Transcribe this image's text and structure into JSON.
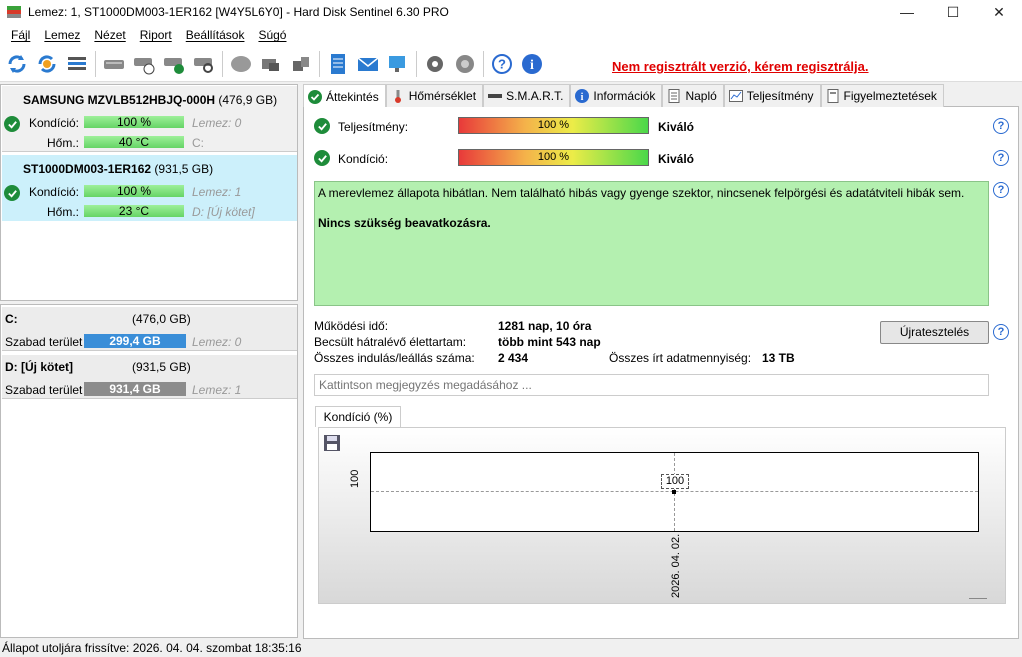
{
  "window": {
    "title": "Lemez: 1, ST1000DM003-1ER162 [W4Y5L6Y0]  -  Hard Disk Sentinel 6.30 PRO",
    "minimize": "—",
    "maximize": "☐",
    "close": "✕"
  },
  "menu": [
    "Fájl",
    "Lemez",
    "Nézet",
    "Riport",
    "Beállítások",
    "Súgó"
  ],
  "toolbar": {
    "registration_link": "Nem regisztrált verzió, kérem regisztrálja."
  },
  "disks": [
    {
      "name": "SAMSUNG MZVLB512HBJQ-000H",
      "size": "(476,9 GB)",
      "condition_label": "Kondíció:",
      "condition_value": "100 %",
      "temp_label": "Hőm.:",
      "temp_value": "40 °C",
      "disk_ref": "Lemez: 0",
      "volume": "C:"
    },
    {
      "name": "ST1000DM003-1ER162",
      "size": "(931,5 GB)",
      "condition_label": "Kondíció:",
      "condition_value": "100 %",
      "temp_label": "Hőm.:",
      "temp_value": "23 °C",
      "disk_ref": "Lemez: 1",
      "volume": "D: [Új kötet]"
    }
  ],
  "volumes": [
    {
      "name": "C:",
      "size": "(476,0 GB)",
      "free_label": "Szabad terület",
      "free_value": "299,4 GB",
      "free_color": "#3a8ed8",
      "disk_ref": "Lemez: 0"
    },
    {
      "name": "D: [Új kötet]",
      "size": "(931,5 GB)",
      "free_label": "Szabad terület",
      "free_value": "931,4 GB",
      "free_color": "#8c8c8c",
      "disk_ref": "Lemez: 1"
    }
  ],
  "tabs": [
    "Áttekintés",
    "Hőmérséklet",
    "S.M.A.R.T.",
    "Információk",
    "Napló",
    "Teljesítmény",
    "Figyelmeztetések"
  ],
  "overview": {
    "performance_label": "Teljesítmény:",
    "performance_value": "100 %",
    "performance_rating": "Kiváló",
    "condition_label": "Kondíció:",
    "condition_value": "100 %",
    "condition_rating": "Kiváló",
    "status_text": "A merevlemez állapota hibátlan. Nem található hibás vagy gyenge szektor, nincsenek felpörgési és adatátviteli hibák sem.",
    "status_action": "Nincs szükség beavatkozásra.",
    "uptime_label": "Működési idő:",
    "uptime_value": "1281 nap, 10 óra",
    "remaining_label": "Becsült hátralévő élettartam:",
    "remaining_value": "több mint 543 nap",
    "startstop_label": "Összes indulás/leállás száma:",
    "startstop_value": "2 434",
    "written_label": "Összes írt adatmennyiség:",
    "written_value": "13 TB",
    "retest_button": "Újratesztelés",
    "comment_placeholder": "Kattintson megjegyzés megadásához ..."
  },
  "chart_tab": "Kondíció  (%)",
  "chart_data": {
    "type": "line",
    "x": [
      "2026. 04. 02."
    ],
    "series": [
      {
        "values": [
          100
        ]
      }
    ],
    "point_label": "100",
    "y_tick": "100",
    "x_tick": "2026. 04. 02."
  },
  "statusbar": "Állapot utoljára frissítve: 2026. 04. 04. szombat 18:35:16"
}
